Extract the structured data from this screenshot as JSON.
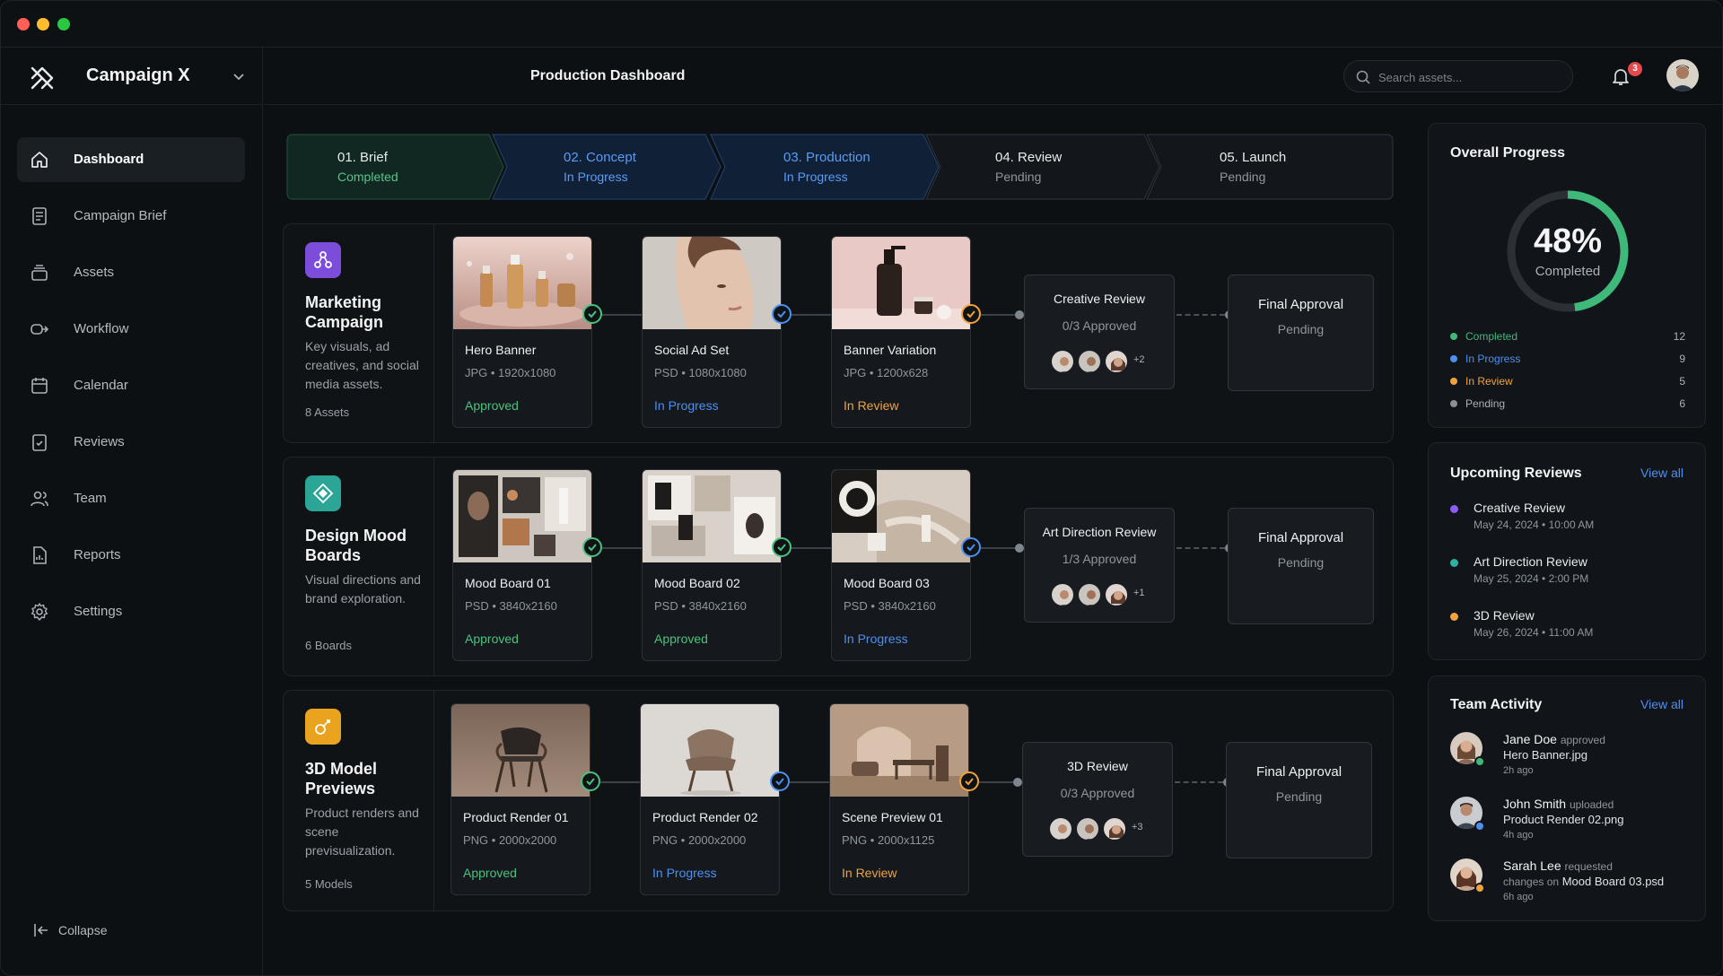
{
  "app": {
    "campaign_name": "Campaign X",
    "page_title": "Production Dashboard"
  },
  "sidebar": {
    "items": [
      {
        "label": "Dashboard",
        "icon": "home-icon"
      },
      {
        "label": "Campaign Brief",
        "icon": "document-icon"
      },
      {
        "label": "Assets",
        "icon": "layers-icon"
      },
      {
        "label": "Workflow",
        "icon": "workflow-icon"
      },
      {
        "label": "Calendar",
        "icon": "calendar-icon"
      },
      {
        "label": "Reviews",
        "icon": "clipboard-check-icon"
      },
      {
        "label": "Team",
        "icon": "users-icon"
      },
      {
        "label": "Reports",
        "icon": "report-icon"
      },
      {
        "label": "Settings",
        "icon": "gear-icon"
      }
    ],
    "collapse_label": "Collapse"
  },
  "header": {
    "search_placeholder": "Search assets...",
    "notification_count": "3"
  },
  "stages": [
    {
      "name": "01. Brief",
      "status": "Completed"
    },
    {
      "name": "02. Concept",
      "status": "In Progress"
    },
    {
      "name": "03. Production",
      "status": "In Progress"
    },
    {
      "name": "04. Review",
      "status": "Pending"
    },
    {
      "name": "05. Launch",
      "status": "Pending"
    }
  ],
  "workflows": [
    {
      "title": "Marketing Campaign",
      "description": "Key visuals, ad creatives, and social media assets.",
      "count": "8 Assets",
      "assets": [
        {
          "name": "Hero Banner",
          "meta": "JPG • 1920x1080",
          "status": "Approved"
        },
        {
          "name": "Social Ad Set",
          "meta": "PSD • 1080x1080",
          "status": "In Progress"
        },
        {
          "name": "Banner Variation",
          "meta": "JPG • 1200x628",
          "status": "In Review"
        }
      ],
      "review": {
        "title": "Creative Review",
        "status": "0/3 Approved",
        "more": "+2"
      },
      "final": {
        "title": "Final Approval",
        "status": "Pending"
      }
    },
    {
      "title": "Design Mood Boards",
      "description": "Visual directions and brand exploration.",
      "count": "6 Boards",
      "assets": [
        {
          "name": "Mood Board 01",
          "meta": "PSD • 3840x2160",
          "status": "Approved"
        },
        {
          "name": "Mood Board 02",
          "meta": "PSD • 3840x2160",
          "status": "Approved"
        },
        {
          "name": "Mood Board 03",
          "meta": "PSD • 3840x2160",
          "status": "In Progress"
        }
      ],
      "review": {
        "title": "Art Direction Review",
        "status": "1/3 Approved",
        "more": "+1"
      },
      "final": {
        "title": "Final Approval",
        "status": "Pending"
      }
    },
    {
      "title": "3D Model Previews",
      "description": "Product renders and scene previsualization.",
      "count": "5 Models",
      "assets": [
        {
          "name": "Product Render 01",
          "meta": "PNG • 2000x2000",
          "status": "Approved"
        },
        {
          "name": "Product Render 02",
          "meta": "PNG • 2000x2000",
          "status": "In Progress"
        },
        {
          "name": "Scene Preview 01",
          "meta": "PNG • 2000x1125",
          "status": "In Review"
        }
      ],
      "review": {
        "title": "3D Review",
        "status": "0/3 Approved",
        "more": "+3"
      },
      "final": {
        "title": "Final Approval",
        "status": "Pending"
      }
    }
  ],
  "overall_progress": {
    "title": "Overall Progress",
    "percent_label": "48%",
    "percent": 48,
    "caption": "Completed",
    "legend": [
      {
        "label": "Completed",
        "value": "12",
        "color": "#3fb97a"
      },
      {
        "label": "In Progress",
        "value": "9",
        "color": "#4d8ff0"
      },
      {
        "label": "In Review",
        "value": "5",
        "color": "#f0a23c"
      },
      {
        "label": "Pending",
        "value": "6",
        "color": "#8a9198"
      }
    ]
  },
  "upcoming_reviews": {
    "title": "Upcoming Reviews",
    "view_all": "View all",
    "items": [
      {
        "name": "Creative Review",
        "time": "May 24, 2024 • 10:00 AM",
        "color": "#8b5cf6"
      },
      {
        "name": "Art Direction Review",
        "time": "May 25, 2024 • 2:00 PM",
        "color": "#2fb3a0"
      },
      {
        "name": "3D Review",
        "time": "May 26, 2024 • 11:00 AM",
        "color": "#f0a23c"
      }
    ]
  },
  "team_activity": {
    "title": "Team Activity",
    "view_all": "View all",
    "items": [
      {
        "user": "Jane Doe",
        "action": "approved",
        "object_prefix": "",
        "object": "Hero Banner.jpg",
        "time": "2h ago",
        "status_color": "#3fb97a"
      },
      {
        "user": "John Smith",
        "action": "uploaded",
        "object_prefix": "",
        "object": "Product Render 02.png",
        "time": "4h ago",
        "status_color": "#4d8ff0"
      },
      {
        "user": "Sarah Lee",
        "action": "requested",
        "object_prefix": "changes on",
        "object": "Mood Board 03.psd",
        "time": "6h ago",
        "status_color": "#f0a23c"
      }
    ]
  },
  "colors": {
    "approved": "#49c27e",
    "in_progress": "#4d8ff0",
    "in_review": "#f0a23c",
    "completed_stage": "#55c58a",
    "progress_stage": "#5b9bf4",
    "pending": "#8e969e"
  }
}
